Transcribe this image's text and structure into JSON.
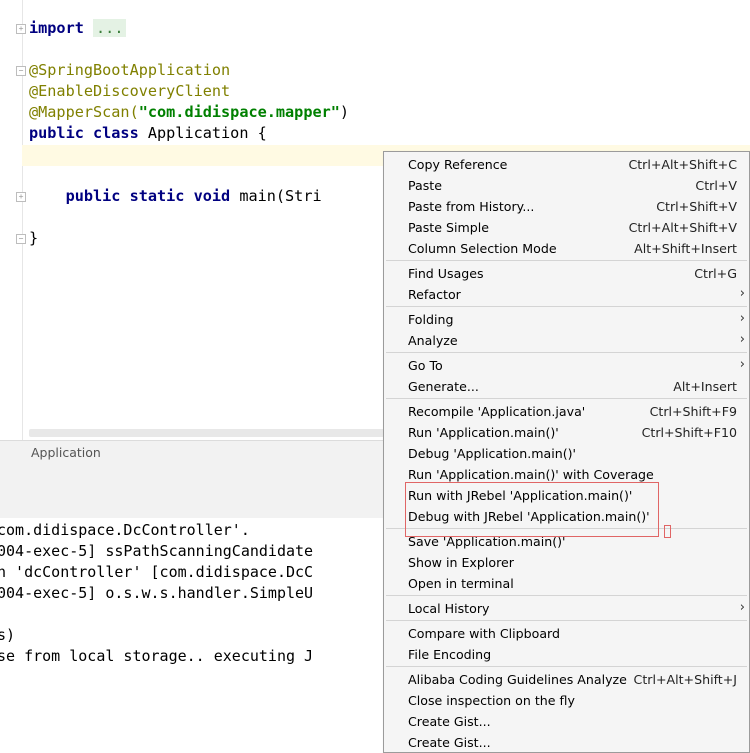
{
  "editor": {
    "line_import": "import",
    "import_fold": "...",
    "annotation_boot": "@SpringBootApplication",
    "annotation_discovery": "@EnableDiscoveryClient",
    "annotation_mapper": "@MapperScan(",
    "mapper_arg": "\"com.didispace.mapper\"",
    "mapper_close": ")",
    "class_keywords": "public class",
    "class_name": " Application {",
    "method_keywords": "public static void",
    "method_rest": " main(Stri",
    "closing_brace": "}"
  },
  "breadcrumb": {
    "label": "Application"
  },
  "console": {
    "lines": [
      "com.didispace.DcController'.",
      "004-exec-5] ssPathScanningCandidate",
      "n 'dcController' [com.didispace.DcC",
      "004-exec-5] o.s.w.s.handler.SimpleU",
      "",
      "s)",
      "se from local storage.. executing J"
    ]
  },
  "menu": {
    "items": [
      {
        "label": "Copy Reference",
        "shortcut": "Ctrl+Alt+Shift+C"
      },
      {
        "label": "Paste",
        "shortcut": "Ctrl+V"
      },
      {
        "label": "Paste from History...",
        "shortcut": "Ctrl+Shift+V"
      },
      {
        "label": "Paste Simple",
        "shortcut": "Ctrl+Alt+Shift+V"
      },
      {
        "label": "Column Selection Mode",
        "shortcut": "Alt+Shift+Insert"
      },
      {
        "label": "Find Usages",
        "shortcut": "Ctrl+G"
      },
      {
        "label": "Refactor",
        "shortcut": ""
      },
      {
        "label": "Folding",
        "shortcut": ""
      },
      {
        "label": "Analyze",
        "shortcut": ""
      },
      {
        "label": "Go To",
        "shortcut": ""
      },
      {
        "label": "Generate...",
        "shortcut": "Alt+Insert"
      },
      {
        "label": "Recompile 'Application.java'",
        "shortcut": "Ctrl+Shift+F9"
      },
      {
        "label": "Run 'Application.main()'",
        "shortcut": "Ctrl+Shift+F10"
      },
      {
        "label": "Debug 'Application.main()'",
        "shortcut": ""
      },
      {
        "label": "Run 'Application.main()' with Coverage",
        "shortcut": ""
      },
      {
        "label": "Run with JRebel 'Application.main()'",
        "shortcut": ""
      },
      {
        "label": "Debug with JRebel 'Application.main()'",
        "shortcut": ""
      },
      {
        "label": "Save 'Application.main()'",
        "shortcut": ""
      },
      {
        "label": "Show in Explorer",
        "shortcut": ""
      },
      {
        "label": "Open in terminal",
        "shortcut": ""
      },
      {
        "label": "Local History",
        "shortcut": ""
      },
      {
        "label": "Compare with Clipboard",
        "shortcut": ""
      },
      {
        "label": "File Encoding",
        "shortcut": ""
      },
      {
        "label": "Alibaba Coding Guidelines Analyze",
        "shortcut": "Ctrl+Alt+Shift+J"
      },
      {
        "label": "Close inspection on the fly",
        "shortcut": ""
      },
      {
        "label": "Create Gist...",
        "shortcut": ""
      },
      {
        "label": "Create Gist...",
        "shortcut": ""
      }
    ]
  }
}
